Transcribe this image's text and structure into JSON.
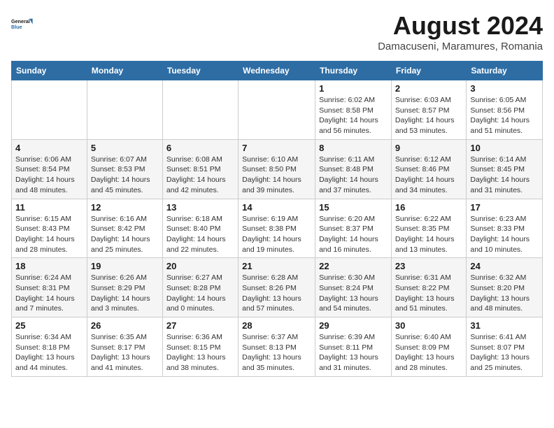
{
  "logo": {
    "line1": "General",
    "line2": "Blue"
  },
  "title": "August 2024",
  "location": "Damacuseni, Maramures, Romania",
  "weekdays": [
    "Sunday",
    "Monday",
    "Tuesday",
    "Wednesday",
    "Thursday",
    "Friday",
    "Saturday"
  ],
  "weeks": [
    [
      {
        "day": "",
        "info": ""
      },
      {
        "day": "",
        "info": ""
      },
      {
        "day": "",
        "info": ""
      },
      {
        "day": "",
        "info": ""
      },
      {
        "day": "1",
        "info": "Sunrise: 6:02 AM\nSunset: 8:58 PM\nDaylight: 14 hours and 56 minutes."
      },
      {
        "day": "2",
        "info": "Sunrise: 6:03 AM\nSunset: 8:57 PM\nDaylight: 14 hours and 53 minutes."
      },
      {
        "day": "3",
        "info": "Sunrise: 6:05 AM\nSunset: 8:56 PM\nDaylight: 14 hours and 51 minutes."
      }
    ],
    [
      {
        "day": "4",
        "info": "Sunrise: 6:06 AM\nSunset: 8:54 PM\nDaylight: 14 hours and 48 minutes."
      },
      {
        "day": "5",
        "info": "Sunrise: 6:07 AM\nSunset: 8:53 PM\nDaylight: 14 hours and 45 minutes."
      },
      {
        "day": "6",
        "info": "Sunrise: 6:08 AM\nSunset: 8:51 PM\nDaylight: 14 hours and 42 minutes."
      },
      {
        "day": "7",
        "info": "Sunrise: 6:10 AM\nSunset: 8:50 PM\nDaylight: 14 hours and 39 minutes."
      },
      {
        "day": "8",
        "info": "Sunrise: 6:11 AM\nSunset: 8:48 PM\nDaylight: 14 hours and 37 minutes."
      },
      {
        "day": "9",
        "info": "Sunrise: 6:12 AM\nSunset: 8:46 PM\nDaylight: 14 hours and 34 minutes."
      },
      {
        "day": "10",
        "info": "Sunrise: 6:14 AM\nSunset: 8:45 PM\nDaylight: 14 hours and 31 minutes."
      }
    ],
    [
      {
        "day": "11",
        "info": "Sunrise: 6:15 AM\nSunset: 8:43 PM\nDaylight: 14 hours and 28 minutes."
      },
      {
        "day": "12",
        "info": "Sunrise: 6:16 AM\nSunset: 8:42 PM\nDaylight: 14 hours and 25 minutes."
      },
      {
        "day": "13",
        "info": "Sunrise: 6:18 AM\nSunset: 8:40 PM\nDaylight: 14 hours and 22 minutes."
      },
      {
        "day": "14",
        "info": "Sunrise: 6:19 AM\nSunset: 8:38 PM\nDaylight: 14 hours and 19 minutes."
      },
      {
        "day": "15",
        "info": "Sunrise: 6:20 AM\nSunset: 8:37 PM\nDaylight: 14 hours and 16 minutes."
      },
      {
        "day": "16",
        "info": "Sunrise: 6:22 AM\nSunset: 8:35 PM\nDaylight: 14 hours and 13 minutes."
      },
      {
        "day": "17",
        "info": "Sunrise: 6:23 AM\nSunset: 8:33 PM\nDaylight: 14 hours and 10 minutes."
      }
    ],
    [
      {
        "day": "18",
        "info": "Sunrise: 6:24 AM\nSunset: 8:31 PM\nDaylight: 14 hours and 7 minutes."
      },
      {
        "day": "19",
        "info": "Sunrise: 6:26 AM\nSunset: 8:29 PM\nDaylight: 14 hours and 3 minutes."
      },
      {
        "day": "20",
        "info": "Sunrise: 6:27 AM\nSunset: 8:28 PM\nDaylight: 14 hours and 0 minutes."
      },
      {
        "day": "21",
        "info": "Sunrise: 6:28 AM\nSunset: 8:26 PM\nDaylight: 13 hours and 57 minutes."
      },
      {
        "day": "22",
        "info": "Sunrise: 6:30 AM\nSunset: 8:24 PM\nDaylight: 13 hours and 54 minutes."
      },
      {
        "day": "23",
        "info": "Sunrise: 6:31 AM\nSunset: 8:22 PM\nDaylight: 13 hours and 51 minutes."
      },
      {
        "day": "24",
        "info": "Sunrise: 6:32 AM\nSunset: 8:20 PM\nDaylight: 13 hours and 48 minutes."
      }
    ],
    [
      {
        "day": "25",
        "info": "Sunrise: 6:34 AM\nSunset: 8:18 PM\nDaylight: 13 hours and 44 minutes."
      },
      {
        "day": "26",
        "info": "Sunrise: 6:35 AM\nSunset: 8:17 PM\nDaylight: 13 hours and 41 minutes."
      },
      {
        "day": "27",
        "info": "Sunrise: 6:36 AM\nSunset: 8:15 PM\nDaylight: 13 hours and 38 minutes."
      },
      {
        "day": "28",
        "info": "Sunrise: 6:37 AM\nSunset: 8:13 PM\nDaylight: 13 hours and 35 minutes."
      },
      {
        "day": "29",
        "info": "Sunrise: 6:39 AM\nSunset: 8:11 PM\nDaylight: 13 hours and 31 minutes."
      },
      {
        "day": "30",
        "info": "Sunrise: 6:40 AM\nSunset: 8:09 PM\nDaylight: 13 hours and 28 minutes."
      },
      {
        "day": "31",
        "info": "Sunrise: 6:41 AM\nSunset: 8:07 PM\nDaylight: 13 hours and 25 minutes."
      }
    ]
  ]
}
